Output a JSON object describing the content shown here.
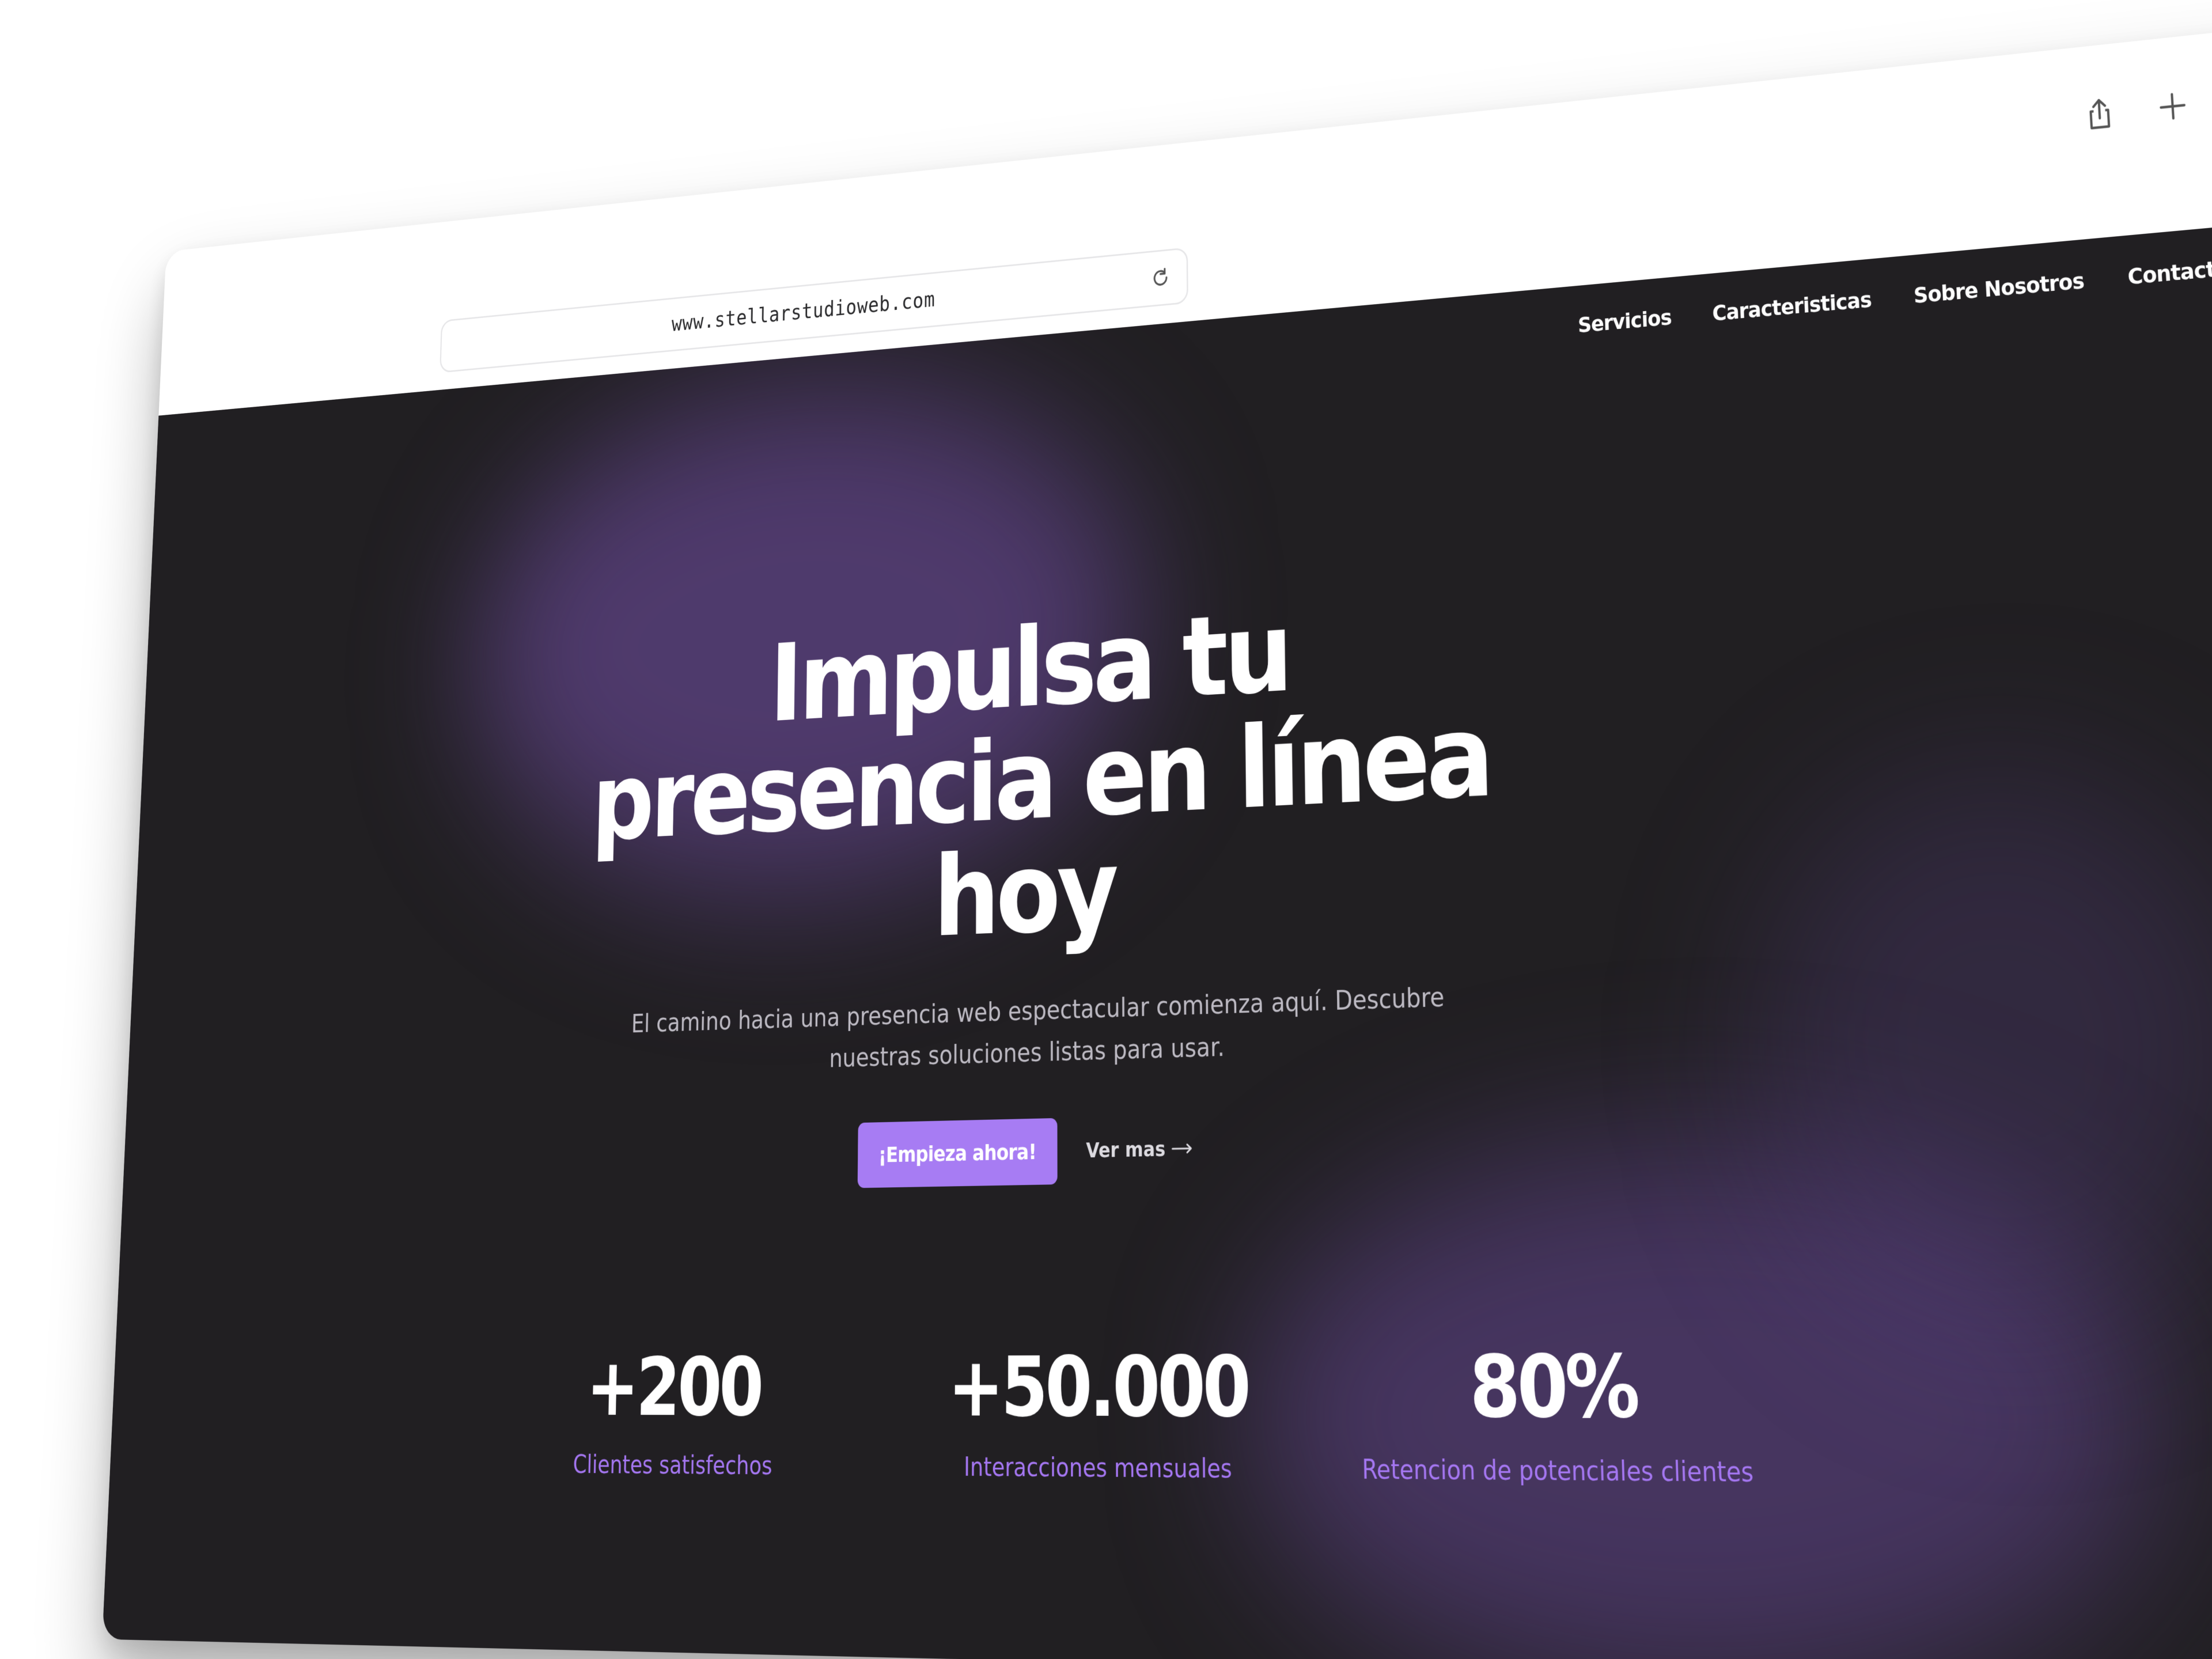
{
  "browser": {
    "url": "www.stellarstudioweb.com",
    "toolbar_icons": [
      "share-icon",
      "new-tab-plus-icon",
      "tab-overview-icon"
    ],
    "reload_icon": "reload-icon"
  },
  "nav": {
    "items": [
      {
        "label": "Servicios"
      },
      {
        "label": "Caracteristicas"
      },
      {
        "label": "Sobre Nosotros"
      },
      {
        "label": "Contactanos"
      }
    ]
  },
  "hero": {
    "title": "Impulsa tu presencia en línea hoy",
    "subtitle": "El camino hacia una presencia web espectacular comienza aquí. Descubre nuestras soluciones listas para usar.",
    "primary_cta": "¡Empieza ahora!",
    "secondary_cta": "Ver mas",
    "secondary_cta_icon": "arrow-right-icon"
  },
  "stats": [
    {
      "value": "+200",
      "label": "Clientes satisfechos"
    },
    {
      "value": "+50.000",
      "label": "Interacciones mensuales"
    },
    {
      "value": "80%",
      "label": "Retencion de potenciales clientes"
    }
  ],
  "colors": {
    "page_background": "#211f22",
    "accent": "#a77cf3",
    "accent_text": "#a577f2",
    "glow": "#7450aa"
  }
}
